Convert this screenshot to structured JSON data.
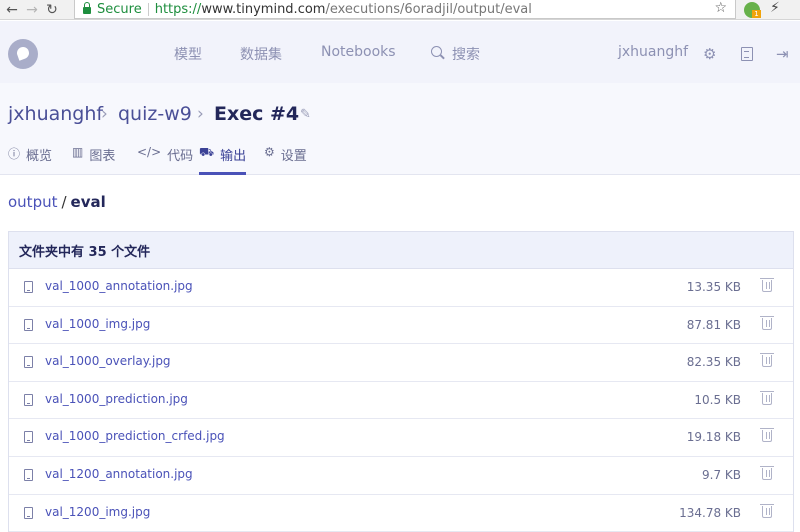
{
  "browser": {
    "secure_label": "Secure",
    "url_scheme": "https://",
    "url_host": "www.tinymind.com",
    "url_path": "/executions/6oradjil/output/eval",
    "ext_badge": "1"
  },
  "topnav": {
    "items": [
      "模型",
      "数据集",
      "Notebooks"
    ],
    "search_label": "搜索",
    "username": "jxhuanghf"
  },
  "breadcrumb": {
    "user": "jxhuanghf",
    "project": "quiz-w9",
    "current": "Exec #4"
  },
  "tabs": [
    {
      "label": "概览",
      "icon": "info-icon"
    },
    {
      "label": "图表",
      "icon": "chart-icon"
    },
    {
      "label": "代码",
      "icon": "code-icon"
    },
    {
      "label": "输出",
      "icon": "truck-icon",
      "active": true
    },
    {
      "label": "设置",
      "icon": "gear-icon"
    }
  ],
  "path": {
    "parent": "output",
    "separator": "/",
    "current": "eval"
  },
  "folder": {
    "summary": "文件夹中有 35 个文件",
    "files": [
      {
        "name": "val_1000_annotation.jpg",
        "size": "13.35 KB"
      },
      {
        "name": "val_1000_img.jpg",
        "size": "87.81 KB"
      },
      {
        "name": "val_1000_overlay.jpg",
        "size": "82.35 KB"
      },
      {
        "name": "val_1000_prediction.jpg",
        "size": "10.5 KB"
      },
      {
        "name": "val_1000_prediction_crfed.jpg",
        "size": "19.18 KB"
      },
      {
        "name": "val_1200_annotation.jpg",
        "size": "9.7 KB"
      },
      {
        "name": "val_1200_img.jpg",
        "size": "134.78 KB"
      }
    ]
  },
  "colors": {
    "accent": "#4a52b8",
    "secure_green": "#1e8e3e",
    "topbar_bg": "#f2f3fb"
  }
}
